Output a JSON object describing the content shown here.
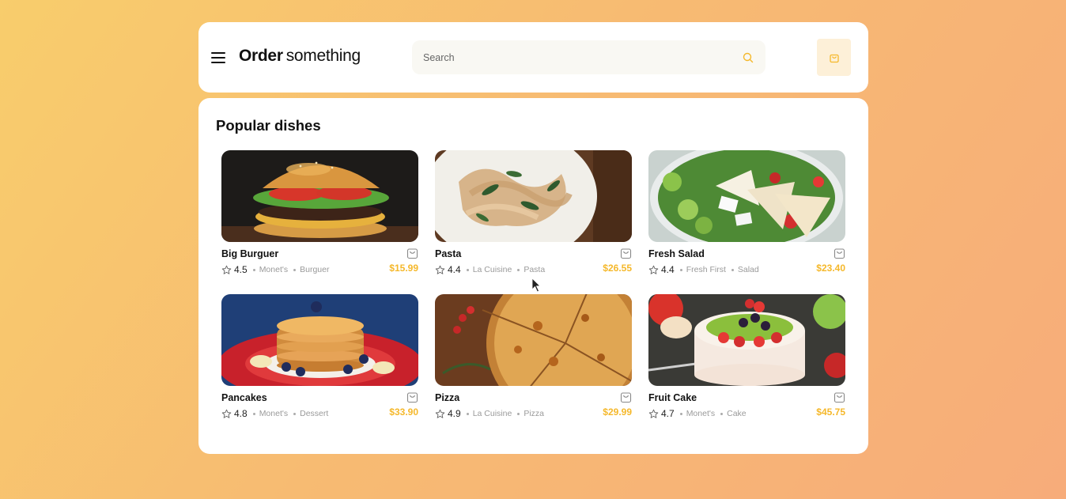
{
  "header": {
    "brand_bold": "Order",
    "brand_light": "something",
    "search_placeholder": "Search"
  },
  "section_title": "Popular dishes",
  "colors": {
    "accent": "#f5b82b",
    "cart_bg": "#fdf0d8"
  },
  "icons": {
    "menu": "hamburger-icon",
    "search": "search-icon",
    "cart": "shopping-bag-icon",
    "rating": "star-icon"
  },
  "dishes": [
    {
      "name": "Big Burguer",
      "rating": "4.5",
      "restaurant": "Monet's",
      "category": "Burguer",
      "price": "$15.99"
    },
    {
      "name": "Pasta",
      "rating": "4.4",
      "restaurant": "La Cuisine",
      "category": "Pasta",
      "price": "$26.55"
    },
    {
      "name": "Fresh Salad",
      "rating": "4.4",
      "restaurant": "Fresh First",
      "category": "Salad",
      "price": "$23.40"
    },
    {
      "name": "Pancakes",
      "rating": "4.8",
      "restaurant": "Monet's",
      "category": "Dessert",
      "price": "$33.90"
    },
    {
      "name": "Pizza",
      "rating": "4.9",
      "restaurant": "La Cuisine",
      "category": "Pizza",
      "price": "$29.99"
    },
    {
      "name": "Fruit Cake",
      "rating": "4.7",
      "restaurant": "Monet's",
      "category": "Cake",
      "price": "$45.75"
    }
  ]
}
